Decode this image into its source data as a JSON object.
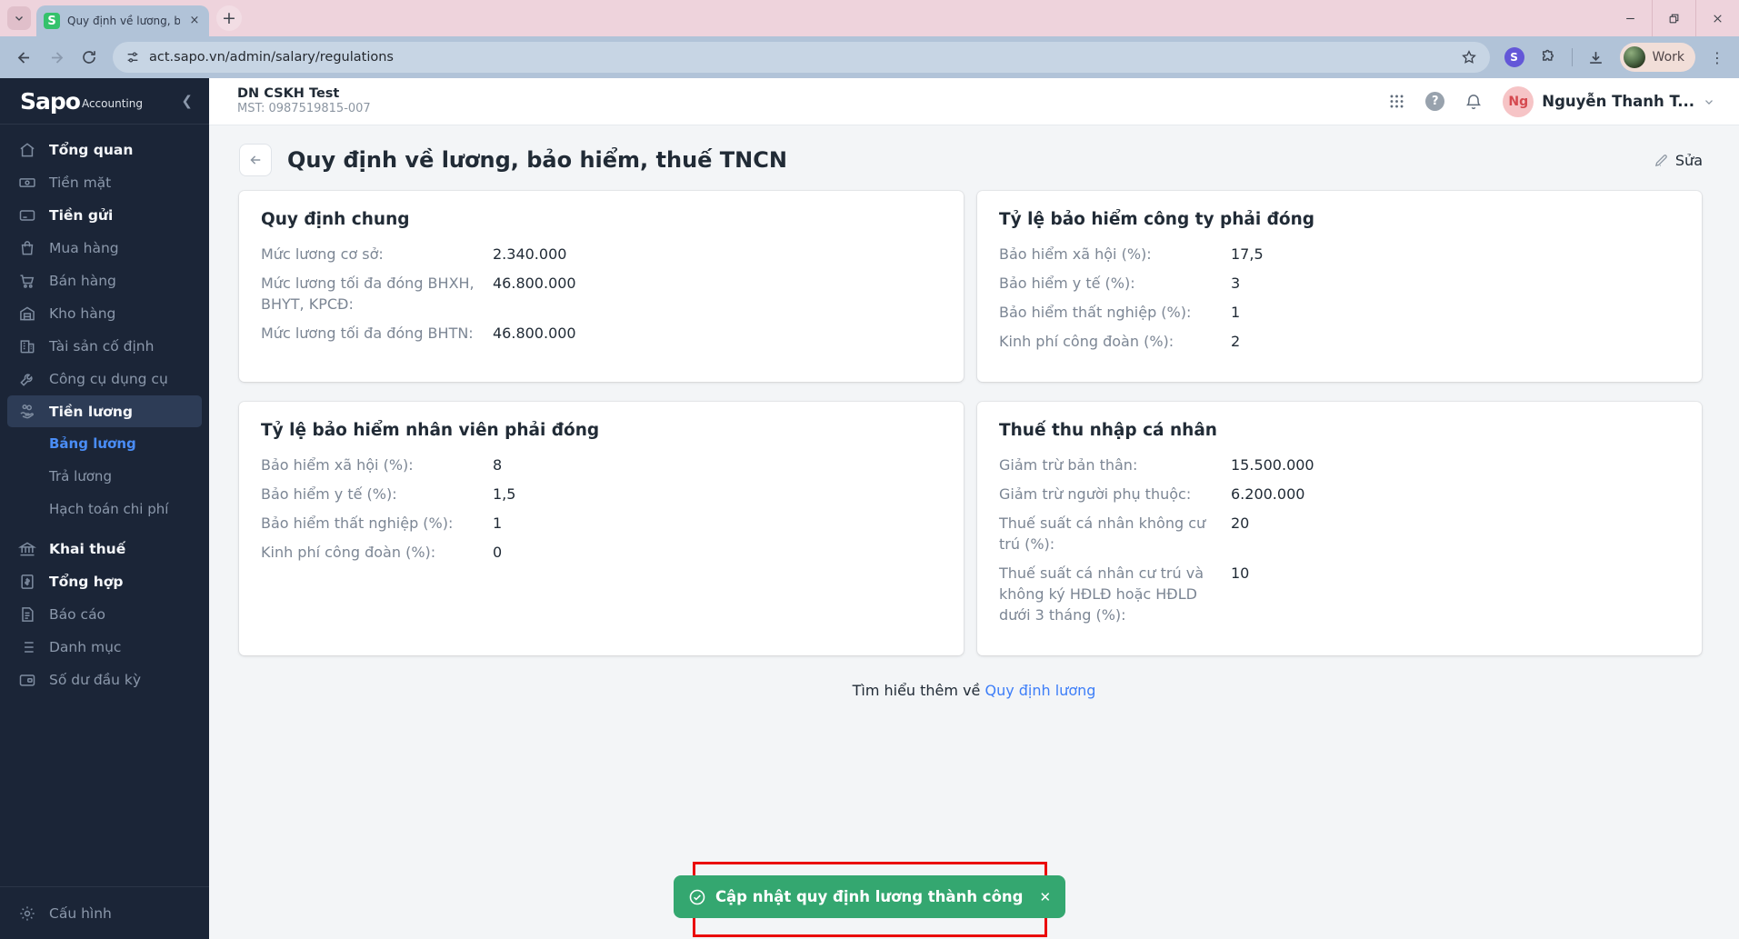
{
  "browser": {
    "tab_title": "Quy định về lương, bảo hiểm, t",
    "favicon_letter": "S",
    "tab_close_glyph": "×",
    "new_tab_glyph": "+",
    "url": "act.sapo.vn/admin/salary/regulations",
    "extension_letter": "S",
    "profile_label": "Work"
  },
  "sidebar": {
    "logo_brand": "Sapo",
    "logo_suffix": "Accounting",
    "items": [
      {
        "label": "Tổng quan"
      },
      {
        "label": "Tiền mặt"
      },
      {
        "label": "Tiền gửi"
      },
      {
        "label": "Mua hàng"
      },
      {
        "label": "Bán hàng"
      },
      {
        "label": "Kho hàng"
      },
      {
        "label": "Tài sản cố định"
      },
      {
        "label": "Công cụ dụng cụ"
      },
      {
        "label": "Tiền lương"
      },
      {
        "label": "Khai thuế"
      },
      {
        "label": "Tổng hợp"
      },
      {
        "label": "Báo cáo"
      },
      {
        "label": "Danh mục"
      },
      {
        "label": "Số dư đầu kỳ"
      }
    ],
    "submenu": [
      {
        "label": "Bảng lương"
      },
      {
        "label": "Trả lương"
      },
      {
        "label": "Hạch toán chi phí"
      }
    ],
    "footer_label": "Cấu hình"
  },
  "header": {
    "company_name": "DN CSKH Test",
    "company_tax": "MST: 0987519815-007",
    "help_glyph": "?",
    "user_initials": "Ng",
    "user_name": "Nguyễn Thanh T..."
  },
  "page": {
    "title": "Quy định về lương, bảo hiểm, thuế TNCN",
    "edit_label": "Sửa",
    "cards": [
      {
        "title": "Quy định chung",
        "rows": [
          {
            "label": "Mức lương cơ sở:",
            "value": "2.340.000"
          },
          {
            "label": "Mức lương tối đa đóng BHXH, BHYT, KPCĐ:",
            "value": "46.800.000"
          },
          {
            "label": "Mức lương tối đa đóng BHTN:",
            "value": "46.800.000"
          }
        ]
      },
      {
        "title": "Tỷ lệ bảo hiểm công ty phải đóng",
        "rows": [
          {
            "label": "Bảo hiểm xã hội (%):",
            "value": "17,5"
          },
          {
            "label": "Bảo hiểm y tế (%):",
            "value": "3"
          },
          {
            "label": "Bảo hiểm thất nghiệp (%):",
            "value": "1"
          },
          {
            "label": "Kinh phí công đoàn (%):",
            "value": "2"
          }
        ]
      },
      {
        "title": "Tỷ lệ bảo hiểm nhân viên phải đóng",
        "rows": [
          {
            "label": "Bảo hiểm xã hội (%):",
            "value": "8"
          },
          {
            "label": "Bảo hiểm y tế (%):",
            "value": "1,5"
          },
          {
            "label": "Bảo hiểm thất nghiệp (%):",
            "value": "1"
          },
          {
            "label": "Kinh phí công đoàn (%):",
            "value": "0"
          }
        ]
      },
      {
        "title": "Thuế thu nhập cá nhân",
        "rows": [
          {
            "label": "Giảm trừ bản thân:",
            "value": "15.500.000"
          },
          {
            "label": "Giảm trừ người phụ thuộc:",
            "value": "6.200.000"
          },
          {
            "label": "Thuế suất cá nhân không cư trú (%):",
            "value": "20"
          },
          {
            "label": "Thuế suất cá nhân cư trú và không ký HĐLĐ hoặc HĐLD dưới 3 tháng (%):",
            "value": "10"
          }
        ]
      }
    ],
    "learn_more_prefix": "Tìm hiểu thêm về ",
    "learn_more_link": "Quy định lương"
  },
  "toast": {
    "message": "Cập nhật quy định lương thành công",
    "close_glyph": "✕"
  },
  "colors": {
    "sidebar_bg": "#1b2537",
    "sidebar_selected_bg": "#2d3c56",
    "submenu_active": "#4a8df6",
    "link_blue": "#3d7ef8",
    "toast_green": "#34a770",
    "annotation_red": "#ea0a0a",
    "tabstrip_pink": "#eed3dc",
    "toolbar_blue": "#b1c3d8"
  }
}
